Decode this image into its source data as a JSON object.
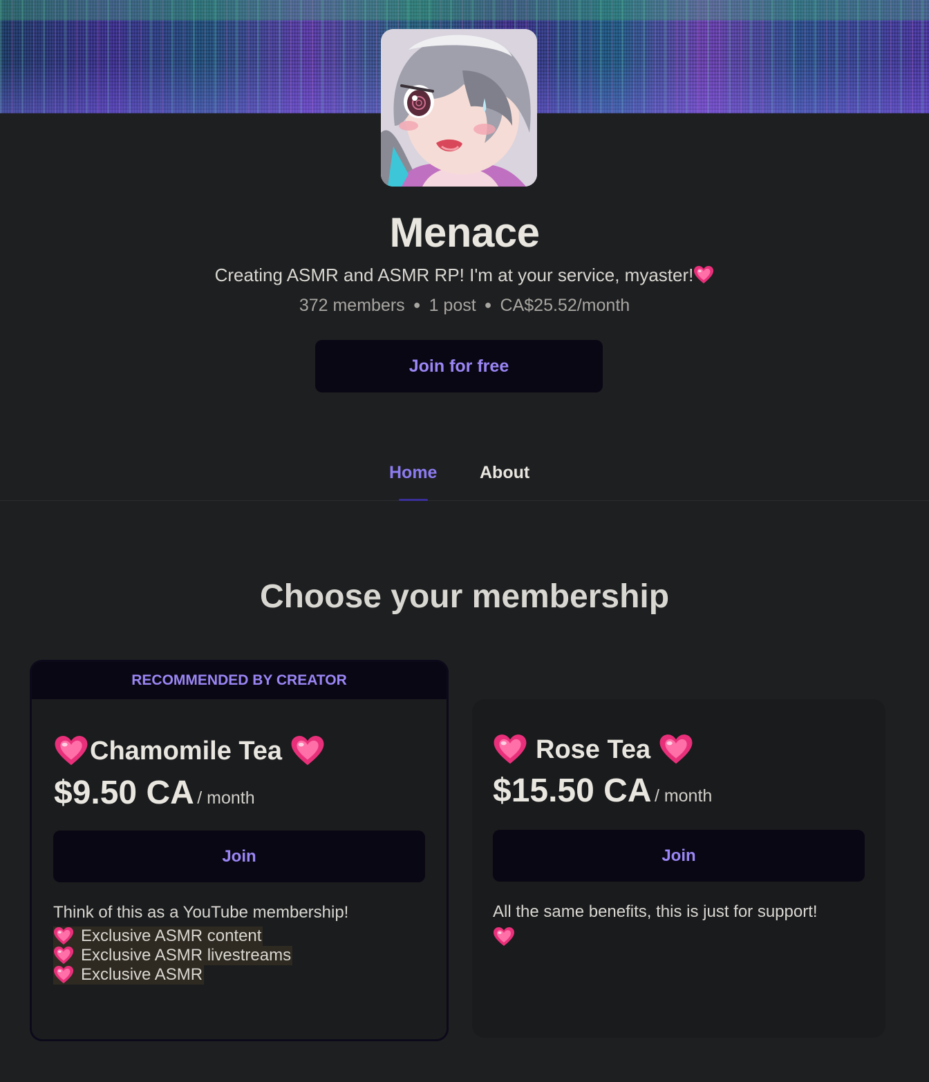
{
  "creator": {
    "name": "Menace",
    "tagline": "Creating ASMR and ASMR RP! I'm at your service, myaster!",
    "stats": {
      "members": "372 members",
      "posts": "1 post",
      "earnings": "CA$25.52/month"
    },
    "join_free_label": "Join for free"
  },
  "tabs": [
    {
      "label": "Home",
      "active": true
    },
    {
      "label": "About",
      "active": false
    }
  ],
  "membership": {
    "section_title": "Choose your membership",
    "tiers": [
      {
        "badge": "RECOMMENDED BY CREATOR",
        "name": "Chamomile Tea",
        "price": "$9.50 CA",
        "period": "/ month",
        "join_label": "Join",
        "description": "Think of this as a YouTube membership!",
        "benefits": [
          "Exclusive ASMR content",
          "Exclusive ASMR livestreams",
          "Exclusive ASMR"
        ]
      },
      {
        "name": "Rose Tea",
        "price": "$15.50 CA",
        "period": "/ month",
        "join_label": "Join",
        "description": "All the same benefits, this is just for support!"
      }
    ]
  },
  "icons": {
    "heart": "sparkling-heart-icon"
  },
  "colors": {
    "background": "#1e1f21",
    "accent": "#9b86f5",
    "button_bg": "#0a0714",
    "heart": "#e8307a"
  }
}
